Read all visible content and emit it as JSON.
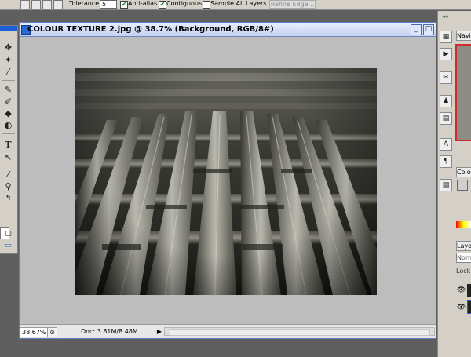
{
  "options_bar": {
    "tolerance_label": "Tolerance:",
    "tolerance_value": "5",
    "anti_alias_label": "Anti-alias",
    "anti_alias_checked": true,
    "contiguous_label": "Contiguous",
    "contiguous_checked": true,
    "sample_all_layers_label": "Sample All Layers",
    "sample_all_layers_checked": false,
    "refine_edge_label": "Refine Edge..."
  },
  "document": {
    "title": "COLOUR TEXTURE 2.jpg @ 38.7% (Background, RGB/8#)",
    "zoom": "38.67%",
    "doc_info": "Doc: 3.81M/8.48M",
    "minimize_glyph": "_",
    "maximize_glyph": "□"
  },
  "toolbox": {
    "tools": [
      "move-icon",
      "magic-wand-icon",
      "eyedropper-icon",
      "brush-icon",
      "history-brush-icon",
      "eraser-icon",
      "paint-bucket-icon",
      "dodge-icon",
      "type-icon",
      "pen-icon",
      "color-sampler-icon",
      "zoom-icon",
      "swap-colors-icon"
    ]
  },
  "dock": {
    "collapse_glyph": "◂◂",
    "buttons": [
      "navigator-icon",
      "actions-icon",
      "tools-preset-icon",
      "clone-source-icon",
      "brushes-icon",
      "character-icon",
      "paragraph-icon",
      "layer-comps-icon"
    ]
  },
  "panels": {
    "navigator_tab": "Navig",
    "colour_tab": "Colou",
    "layers_tab": "Layer",
    "blend_mode": "Norma",
    "lock_label": "Lock:",
    "spectrum_colors": [
      "#ff0000",
      "#ffff00",
      "#ffffff"
    ]
  },
  "colors": {
    "title_bar_start": "#e8eefc",
    "title_bar_end": "#c3d2f2",
    "canvas_gray": "#bdbdbd",
    "workspace_gray": "#5f5f5f",
    "navigator_highlight": "#d02a2a"
  }
}
